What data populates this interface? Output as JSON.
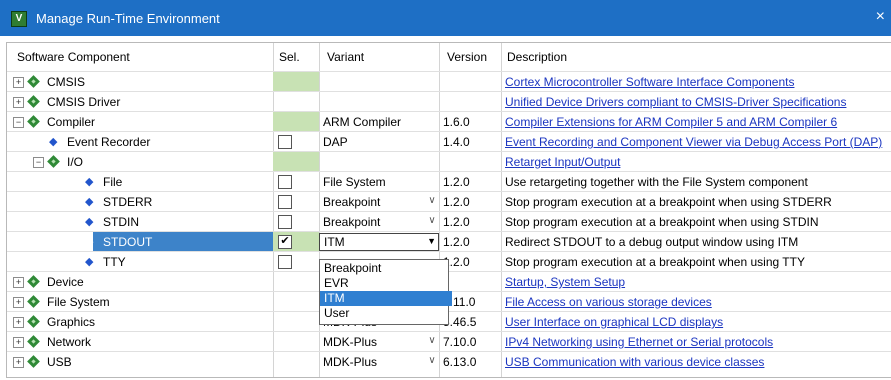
{
  "window": {
    "title": "Manage Run-Time Environment",
    "close": "×"
  },
  "columns": {
    "component": "Software Component",
    "sel": "Sel.",
    "variant": "Variant",
    "version": "Version",
    "description": "Description"
  },
  "rows": [
    {
      "name": "CMSIS",
      "variant": "",
      "version": "",
      "description": "Cortex Microcontroller Software Interface Components"
    },
    {
      "name": "CMSIS Driver",
      "variant": "",
      "version": "",
      "description": "Unified Device Drivers compliant to CMSIS-Driver Specifications"
    },
    {
      "name": "Compiler",
      "variant": "ARM Compiler",
      "version": "1.6.0",
      "description": "Compiler Extensions for ARM Compiler 5 and ARM Compiler 6"
    },
    {
      "name": "Event Recorder",
      "variant": "DAP",
      "version": "1.4.0",
      "description": "Event Recording and Component Viewer via Debug Access Port (DAP)"
    },
    {
      "name": "I/O",
      "variant": "",
      "version": "",
      "description": "Retarget Input/Output"
    },
    {
      "name": "File",
      "variant": "File System",
      "version": "1.2.0",
      "description": "Use retargeting together with the File System component"
    },
    {
      "name": "STDERR",
      "variant": "Breakpoint",
      "version": "1.2.0",
      "description": "Stop program execution at a breakpoint when using STDERR"
    },
    {
      "name": "STDIN",
      "variant": "Breakpoint",
      "version": "1.2.0",
      "description": "Stop program execution at a breakpoint when using STDIN"
    },
    {
      "name": "STDOUT",
      "variant": "ITM",
      "version": "1.2.0",
      "description": "Redirect STDOUT to a debug output window using ITM",
      "checked": true
    },
    {
      "name": "TTY",
      "variant": "",
      "version": "1.2.0",
      "description": "Stop program execution at a breakpoint when using TTY"
    },
    {
      "name": "Device",
      "variant": "",
      "version": "",
      "description": "Startup, System Setup"
    },
    {
      "name": "File System",
      "variant": "",
      "version": "6.11.0",
      "description": "File Access on various storage devices"
    },
    {
      "name": "Graphics",
      "variant": "MDK-Plus",
      "version": "5.46.5",
      "description": "User Interface on graphical LCD displays"
    },
    {
      "name": "Network",
      "variant": "MDK-Plus",
      "version": "7.10.0",
      "description": "IPv4 Networking using Ethernet or Serial protocols"
    },
    {
      "name": "USB",
      "variant": "MDK-Plus",
      "version": "6.13.0",
      "description": "USB Communication with various device classes"
    }
  ],
  "expander": {
    "plus": "+",
    "minus": "−"
  },
  "checkmark": "✔",
  "variant_dropdown": {
    "options": [
      "Breakpoint",
      "EVR",
      "ITM",
      "User"
    ],
    "highlighted": "ITM"
  },
  "icons": {
    "component": "green-diamond-icon",
    "sub_component": "blue-pin-icon"
  },
  "colors": {
    "titlebar": "#1e6fc5",
    "selection": "#3d83c9",
    "sel_green": "#c8e2b4",
    "link": "#1b35c0"
  }
}
